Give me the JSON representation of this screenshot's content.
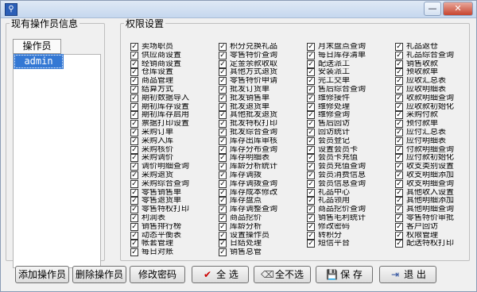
{
  "window": {
    "app_icon_glyph": "⚲",
    "min_glyph": "—",
    "close_glyph": "✕"
  },
  "operators_panel": {
    "legend": "现有操作员信息",
    "header": "操作员",
    "items": [
      "admin"
    ],
    "selected_index": 0
  },
  "permissions_panel": {
    "legend": "权限设置",
    "check_glyph": "✓",
    "columns": [
      [
        "卖场职员",
        "供应商设置",
        "经销商设置",
        "仓库设置",
        "商品管理",
        "结算方式",
        "期初数据导入",
        "期初库存设置",
        "期初库存启用",
        "票据打印设置",
        "采购订单",
        "采购入库",
        "采购核价",
        "采购调价",
        "调价明细查询",
        "采购退货",
        "采购综合查询",
        "零售销售单",
        "零售退货单",
        "零售特权打印",
        "利润表",
        "销售排行榜",
        "动态平衡表",
        "帐套管理",
        "每日对账"
      ],
      [
        "积分兑换礼品",
        "零售特价查询",
        "定金余款收取",
        "其他方式退货",
        "零售特价申请",
        "批发订货单",
        "批发销售单",
        "批发退货单",
        "其他批发退货",
        "批发特权打印",
        "批发综合查询",
        "库存出库审核",
        "库存分布查询",
        "库存明细表",
        "库龄分析统计",
        "库存调拨",
        "库存调拨查询",
        "库存成本修改",
        "库存盘点",
        "库存调整查询",
        "商品挖价",
        "库龄分析",
        "设置操作员",
        "日结处理",
        "销售总管"
      ],
      [
        "月末盘点查询",
        "每日库存清单",
        "配送派工",
        "安装派工",
        "完工交单",
        "售后综合查询",
        "维修接件",
        "维修处理",
        "维修查询",
        "售后回访",
        "回访统计",
        "会员登记",
        "设置会员卡",
        "会员卡充值",
        "会员充值查询",
        "会员消费信息",
        "会员信息查询",
        "礼品中心",
        "礼品领用",
        "商品挖价查询",
        "销售毛利统计",
        "修改密码",
        "转积分",
        "短信平台"
      ],
      [
        "礼品返仓",
        "礼品综合查询",
        "销售收款",
        "预收款单",
        "应收汇总表",
        "应收明细表",
        "收款明细查询",
        "应收款初始化",
        "采购付款",
        "预付款单",
        "应付汇总表",
        "应付明细表",
        "付款明细查询",
        "应付款初始化",
        "收支类别设置",
        "收支明细添加",
        "收支明细查询",
        "其他收入设置",
        "其他明细添加",
        "其他明细查询",
        "零售特价审批",
        "客户回访",
        "权限管理",
        "配送特权打印"
      ]
    ]
  },
  "bottom_buttons": {
    "add_operator": "添加操作员",
    "delete_operator": "删除操作员",
    "change_password": "修改密码",
    "select_all": "全 选",
    "select_none": "全不选",
    "save": "保 存",
    "exit": "退 出"
  },
  "icons": {
    "select_all_icon": "✔",
    "select_none_icon": "⌫",
    "save_icon": "💾",
    "exit_icon": "⇥"
  }
}
